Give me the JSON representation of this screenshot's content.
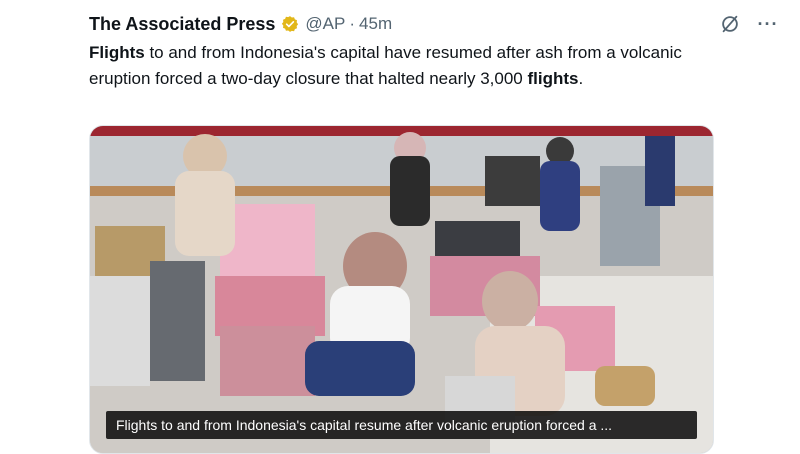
{
  "tweet": {
    "author": "The Associated Press",
    "handle": "@AP",
    "separator": "·",
    "time": "45m",
    "text_parts": {
      "p1": "Flights",
      "p2": " to and from Indonesia's capital have resumed after ash from a volcanic eruption forced a two-day closure that halted nearly 3,000 ",
      "p3": "flights",
      "p4": "."
    },
    "more_label": "···"
  },
  "media": {
    "caption": "Flights to and from Indonesia's capital resume after volcanic eruption forced a ..."
  },
  "colors": {
    "verified_badge": "#e2b719",
    "text": "#0f1419",
    "muted": "#536471"
  }
}
